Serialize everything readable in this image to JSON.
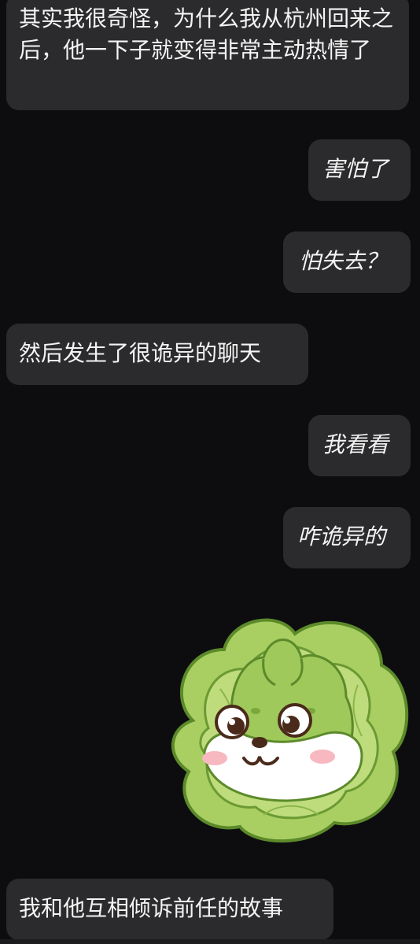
{
  "messages": [
    {
      "side": "left",
      "text": "其实我很奇怪，为什么我从杭州回来之后，他一下子就变得非常主动热情了"
    },
    {
      "side": "right",
      "text": "害怕了"
    },
    {
      "side": "right",
      "text": "怕失去？"
    },
    {
      "side": "left",
      "text": "然后发生了很诡异的聊天"
    },
    {
      "side": "right",
      "text": "我看看"
    },
    {
      "side": "right",
      "text": "咋诡异的"
    },
    {
      "side": "right",
      "type": "sticker",
      "icon": "cabbage-dog-sticker-icon"
    },
    {
      "side": "left",
      "text": "我和他互相倾诉前任的故事"
    }
  ],
  "colors": {
    "background": "#0d0d10",
    "bubble": "#2b2b2d",
    "text": "#f4f4f4"
  }
}
